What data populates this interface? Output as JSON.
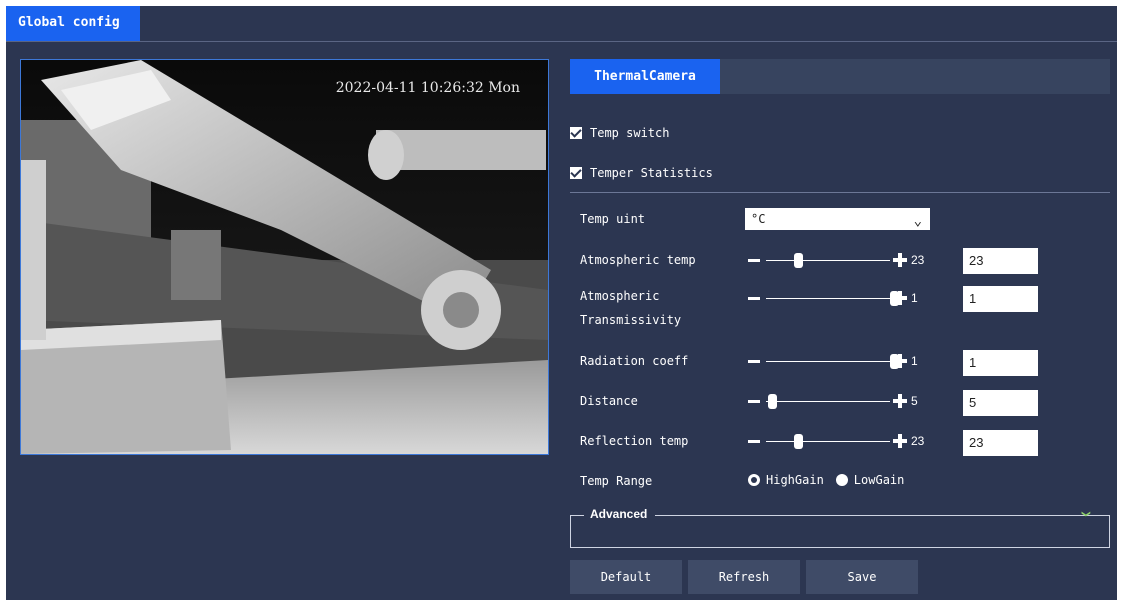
{
  "header": {
    "tab_label": "Global config"
  },
  "video": {
    "timestamp": "2022-04-11 10:26:32 Mon"
  },
  "panel": {
    "tab_label": "ThermalCamera",
    "temp_switch": {
      "label": "Temp switch",
      "checked": true
    },
    "temper_statistics": {
      "label": "Temper Statistics",
      "checked": true
    },
    "temp_unit": {
      "label": "Temp uint",
      "value": "°C"
    },
    "atmospheric_temp": {
      "label": "Atmospheric temp",
      "slider_value": "23",
      "input_value": "23",
      "level": 0.25
    },
    "atmospheric_transmissivity": {
      "label_line1": "Atmospheric",
      "label_line2": "Transmissivity",
      "slider_value": "1",
      "input_value": "1",
      "level": 1.0
    },
    "radiation_coeff": {
      "label": "Radiation coeff",
      "slider_value": "1",
      "input_value": "1",
      "level": 1.0
    },
    "distance": {
      "label": "Distance",
      "slider_value": "5",
      "input_value": "5",
      "level": 0.05
    },
    "reflection_temp": {
      "label": "Reflection temp",
      "slider_value": "23",
      "input_value": "23",
      "level": 0.25
    },
    "temp_range": {
      "label": "Temp Range",
      "options": [
        "HighGain",
        "LowGain"
      ],
      "selected": "HighGain"
    },
    "advanced": {
      "label": "Advanced",
      "icon": "double-chevron-down-icon"
    }
  },
  "buttons": {
    "default": "Default",
    "refresh": "Refresh",
    "save": "Save"
  },
  "colors": {
    "background": "#2c3651",
    "accent": "#1a63f0",
    "button": "#3f4b67"
  }
}
